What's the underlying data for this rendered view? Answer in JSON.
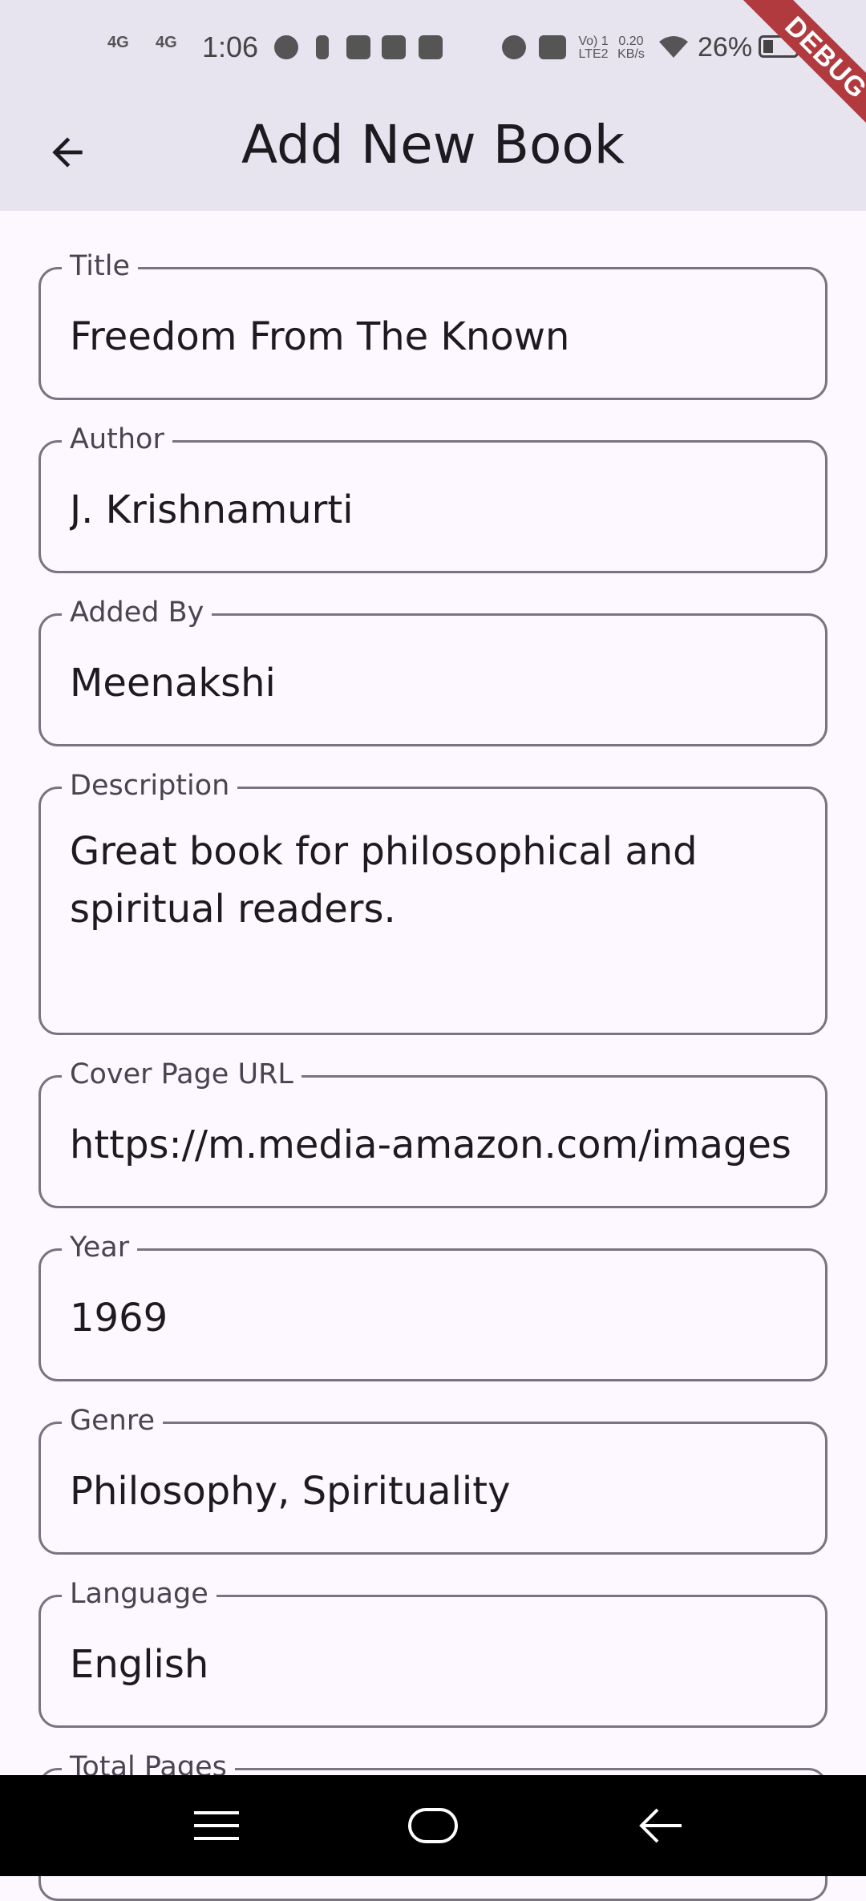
{
  "status_bar": {
    "network_1": "4G",
    "network_2": "4G",
    "time": "1:06",
    "speed_value": "0.20",
    "speed_unit": "KB/s",
    "volte_top": "Vo) 1",
    "volte_bottom": "LTE2",
    "battery_percent": "26%",
    "icons": [
      "whatsapp-icon",
      "usb-icon",
      "youtube-icon",
      "twitter-icon",
      "mail-icon",
      "alarm-icon",
      "vibrate-icon",
      "wifi-icon",
      "battery-icon"
    ]
  },
  "debug_banner": "DEBUG",
  "app_bar": {
    "title": "Add New Book",
    "back_icon": "arrow-back-icon"
  },
  "form": {
    "fields": [
      {
        "label": "Title",
        "value": "Freedom From The Known"
      },
      {
        "label": "Author",
        "value": "J. Krishnamurti"
      },
      {
        "label": "Added By",
        "value": "Meenakshi"
      },
      {
        "label": "Description",
        "value": "Great book for philosophical and spiritual readers."
      },
      {
        "label": "Cover Page URL",
        "value": "https://m.media-amazon.com/images"
      },
      {
        "label": "Year",
        "value": "1969"
      },
      {
        "label": "Genre",
        "value": "Philosophy, Spirituality"
      },
      {
        "label": "Language",
        "value": "English"
      },
      {
        "label": "Total Pages",
        "value": ""
      }
    ]
  },
  "nav_bar": {
    "icons": [
      "menu-icon",
      "home-icon",
      "back-icon"
    ]
  },
  "colors": {
    "app_bar_bg": "#e7e3ef",
    "page_bg": "#fdf7ff",
    "outline": "#79747e",
    "debug_banner": "#b13a3e"
  }
}
